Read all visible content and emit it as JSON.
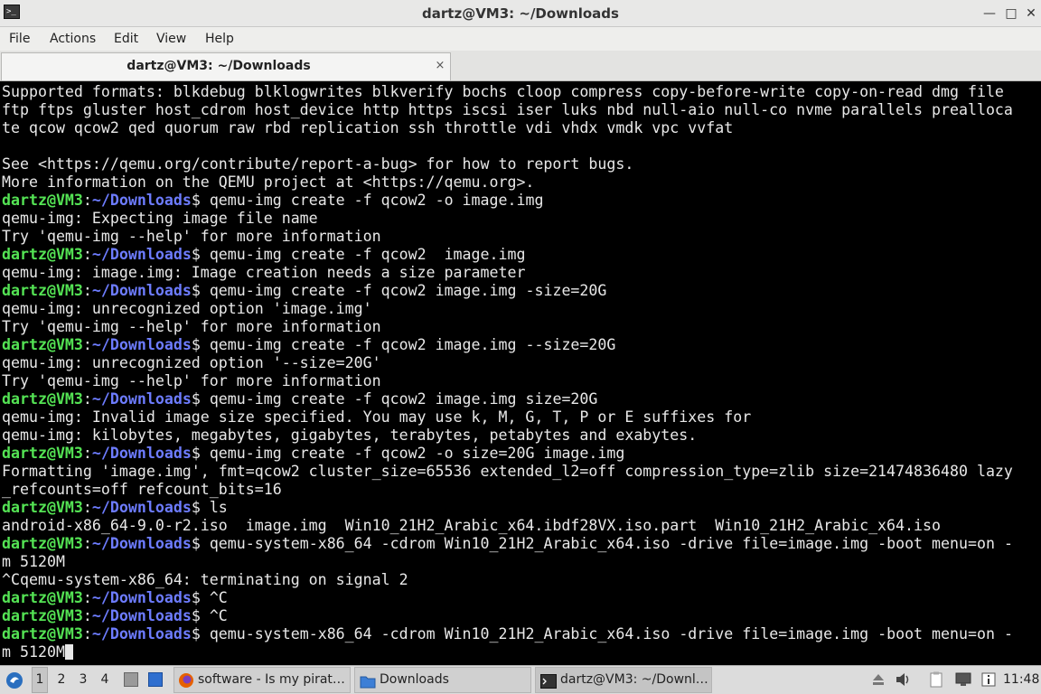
{
  "window": {
    "title": "dartz@VM3: ~/Downloads"
  },
  "menu": {
    "items": [
      "File",
      "Actions",
      "Edit",
      "View",
      "Help"
    ]
  },
  "tab": {
    "label": "dartz@VM3: ~/Downloads",
    "close_glyph": "×"
  },
  "prompt": {
    "user_host": "dartz@VM3",
    "colon": ":",
    "path": "~/Downloads",
    "dollar": "$"
  },
  "terminal": {
    "lines": [
      {
        "text": "Supported formats: blkdebug blklogwrites blkverify bochs cloop compress copy-before-write copy-on-read dmg file"
      },
      {
        "text": "ftp ftps gluster host_cdrom host_device http https iscsi iser luks nbd null-aio null-co nvme parallels prealloca"
      },
      {
        "text": "te qcow qcow2 qed quorum raw rbd replication ssh throttle vdi vhdx vmdk vpc vvfat"
      },
      {
        "text": ""
      },
      {
        "text": "See <https://qemu.org/contribute/report-a-bug> for how to report bugs."
      },
      {
        "text": "More information on the QEMU project at <https://qemu.org>."
      },
      {
        "prompt": true,
        "text": " qemu-img create -f qcow2 -o image.img"
      },
      {
        "text": "qemu-img: Expecting image file name"
      },
      {
        "text": "Try 'qemu-img --help' for more information"
      },
      {
        "prompt": true,
        "text": " qemu-img create -f qcow2  image.img"
      },
      {
        "text": "qemu-img: image.img: Image creation needs a size parameter"
      },
      {
        "prompt": true,
        "text": " qemu-img create -f qcow2 image.img -size=20G"
      },
      {
        "text": "qemu-img: unrecognized option 'image.img'"
      },
      {
        "text": "Try 'qemu-img --help' for more information"
      },
      {
        "prompt": true,
        "text": " qemu-img create -f qcow2 image.img --size=20G"
      },
      {
        "text": "qemu-img: unrecognized option '--size=20G'"
      },
      {
        "text": "Try 'qemu-img --help' for more information"
      },
      {
        "prompt": true,
        "text": " qemu-img create -f qcow2 image.img size=20G"
      },
      {
        "text": "qemu-img: Invalid image size specified. You may use k, M, G, T, P or E suffixes for"
      },
      {
        "text": "qemu-img: kilobytes, megabytes, gigabytes, terabytes, petabytes and exabytes."
      },
      {
        "prompt": true,
        "text": " qemu-img create -f qcow2 -o size=20G image.img"
      },
      {
        "text": "Formatting 'image.img', fmt=qcow2 cluster_size=65536 extended_l2=off compression_type=zlib size=21474836480 lazy"
      },
      {
        "text": "_refcounts=off refcount_bits=16"
      },
      {
        "prompt": true,
        "text": " ls"
      },
      {
        "text": "android-x86_64-9.0-r2.iso  image.img  Win10_21H2_Arabic_x64.ibdf28VX.iso.part  Win10_21H2_Arabic_x64.iso"
      },
      {
        "prompt": true,
        "text": " qemu-system-x86_64 -cdrom Win10_21H2_Arabic_x64.iso -drive file=image.img -boot menu=on -"
      },
      {
        "text": "m 5120M"
      },
      {
        "text": "^Cqemu-system-x86_64: terminating on signal 2"
      },
      {
        "prompt": true,
        "text": " ^C"
      },
      {
        "prompt": true,
        "text": " ^C"
      },
      {
        "prompt": true,
        "text": " qemu-system-x86_64 -cdrom Win10_21H2_Arabic_x64.iso -drive file=image.img -boot menu=on -"
      },
      {
        "text": "m 5120M",
        "cursor": true
      }
    ]
  },
  "taskbar": {
    "workspaces": [
      "1",
      "2",
      "3",
      "4"
    ],
    "tasks": [
      {
        "label": "software - Is my pirat…",
        "icon": "firefox-icon"
      },
      {
        "label": "Downloads",
        "icon": "folder-icon"
      },
      {
        "label": "dartz@VM3: ~/Downl…",
        "icon": "terminal-icon"
      }
    ],
    "clock": "11:48"
  },
  "colors": {
    "prompt_user": "#54e354",
    "prompt_path": "#6d7cff",
    "terminal_fg": "#e8e8e8",
    "terminal_bg": "#000000"
  }
}
